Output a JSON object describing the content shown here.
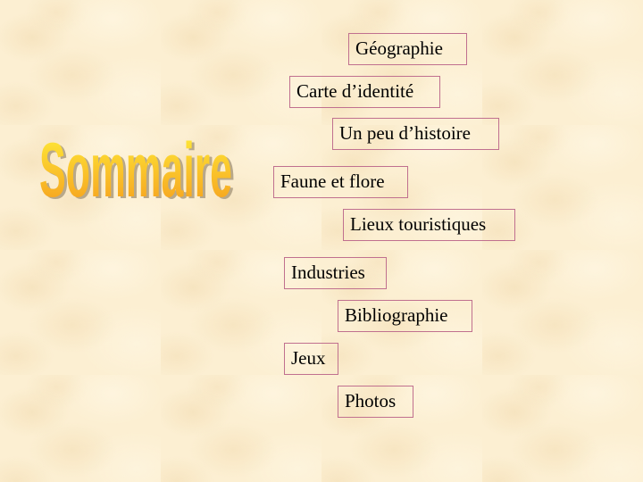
{
  "title": {
    "text": "Sommaire",
    "gradient_top": "#ffef3a",
    "gradient_bottom": "#f59a1c",
    "shadow": "#b8a88a"
  },
  "menu": {
    "items": [
      {
        "label": "Géographie"
      },
      {
        "label": "Carte d’identité"
      },
      {
        "label": "Un peu d’histoire"
      },
      {
        "label": "Faune et flore"
      },
      {
        "label": "Lieux touristiques"
      },
      {
        "label": "Industries"
      },
      {
        "label": "Bibliographie"
      },
      {
        "label": "Jeux"
      },
      {
        "label": "Photos"
      }
    ],
    "border_color": "#c0708f"
  }
}
